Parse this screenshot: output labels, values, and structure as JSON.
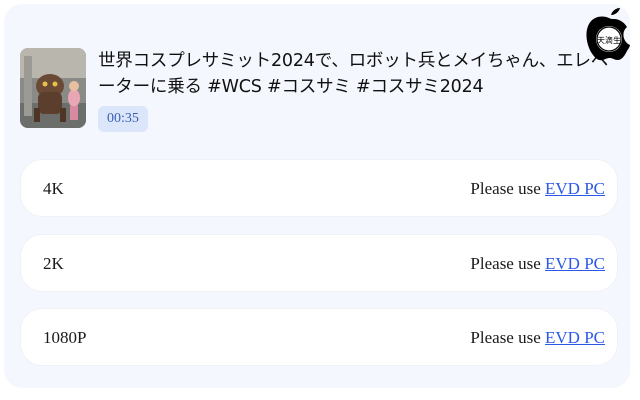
{
  "video": {
    "title": "世界コスプレサミット2024で、ロボット兵とメイちゃん、エレベーターに乗る #WCS #コスサミ #コスサミ2024",
    "duration": "00:35",
    "thumbnail_icon": "video-thumbnail"
  },
  "downloads": [
    {
      "quality": "4K",
      "note": "Please use",
      "link": "EVD PC"
    },
    {
      "quality": "2K",
      "note": "Please use",
      "link": "EVD PC"
    },
    {
      "quality": "1080P",
      "note": "Please use",
      "link": "EVD PC"
    }
  ],
  "watermark": {
    "text": "天滴生",
    "icon": "apple-logo"
  },
  "colors": {
    "card_bg": "#f4f7fd",
    "badge_bg": "#dbe6fb",
    "link": "#2b59e6"
  }
}
